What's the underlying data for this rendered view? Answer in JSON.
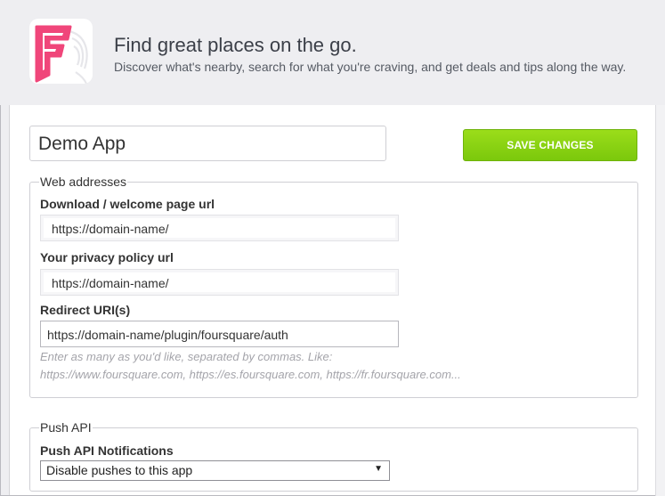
{
  "header": {
    "title": "Find great places on the go.",
    "subtitle": "Discover what's nearby, search for what you're craving, and get deals and tips along the way."
  },
  "form": {
    "app_name_value": "Demo App",
    "save_label": "SAVE CHANGES",
    "web_addresses": {
      "legend": "Web addresses",
      "download_label": "Download / welcome page url",
      "download_value": "https://domain-name/",
      "privacy_label": "Your privacy policy url",
      "privacy_value": "https://domain-name/",
      "redirect_label": "Redirect URI(s)",
      "redirect_value": "https://domain-name/plugin/foursquare/auth",
      "redirect_hint_line1": "Enter as many as you'd like, separated by commas. Like:",
      "redirect_hint_line2": "https://www.foursquare.com, https://es.foursquare.com, https://fr.foursquare.com..."
    },
    "push_api": {
      "legend": "Push API",
      "notifications_label": "Push API Notifications",
      "notifications_selected": "Disable pushes to this app"
    }
  },
  "colors": {
    "brand_pink": "#f0467a",
    "save_green": "#8ed313",
    "page_bg": "#eeeef1"
  },
  "icons": {
    "logo": "foursquare-logo",
    "select_arrow": "dropdown-arrow-icon"
  }
}
